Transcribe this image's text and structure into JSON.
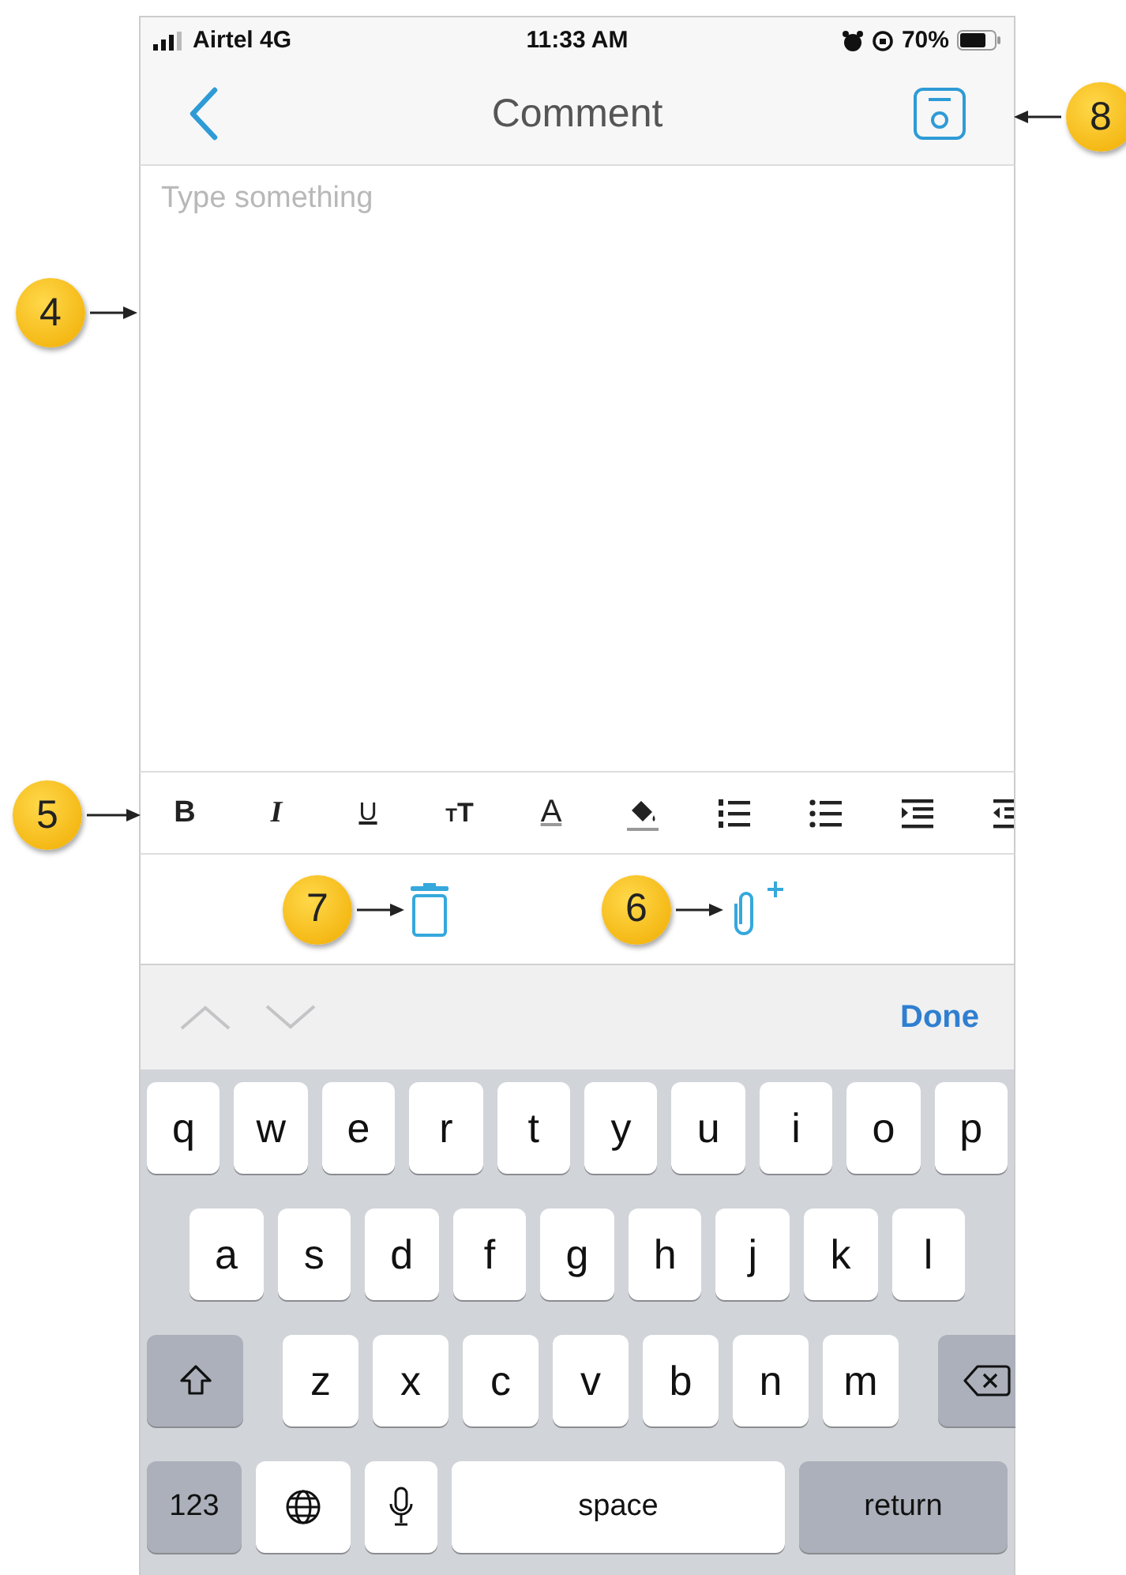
{
  "status_bar": {
    "carrier": "Airtel 4G",
    "time": "11:33 AM",
    "battery": "70%"
  },
  "nav": {
    "title": "Comment",
    "callout": "8"
  },
  "editor": {
    "placeholder": "Type something",
    "callout": "4"
  },
  "format_toolbar": {
    "callout": "5",
    "tools": [
      {
        "kind": "bold",
        "label": "B"
      },
      {
        "kind": "italic",
        "label": "I"
      },
      {
        "kind": "underline",
        "label": "U"
      },
      {
        "kind": "size",
        "label": "TT"
      },
      {
        "kind": "color",
        "label": "A"
      },
      {
        "kind": "fill"
      },
      {
        "kind": "numbered"
      },
      {
        "kind": "bulleted"
      },
      {
        "kind": "indent"
      },
      {
        "kind": "outdent"
      }
    ]
  },
  "actions": [
    {
      "kind": "delete",
      "callout": "7"
    },
    {
      "kind": "attach",
      "callout": "6"
    }
  ],
  "accessory": {
    "done": "Done"
  },
  "keyboard": {
    "rows": [
      {
        "keys": [
          {
            "kind": "letter",
            "label": "q"
          },
          {
            "kind": "letter",
            "label": "w"
          },
          {
            "kind": "letter",
            "label": "e"
          },
          {
            "kind": "letter",
            "label": "r"
          },
          {
            "kind": "letter",
            "label": "t"
          },
          {
            "kind": "letter",
            "label": "y"
          },
          {
            "kind": "letter",
            "label": "u"
          },
          {
            "kind": "letter",
            "label": "i"
          },
          {
            "kind": "letter",
            "label": "o"
          },
          {
            "kind": "letter",
            "label": "p"
          }
        ]
      },
      {
        "keys": [
          {
            "kind": "letter",
            "label": "a"
          },
          {
            "kind": "letter",
            "label": "s"
          },
          {
            "kind": "letter",
            "label": "d"
          },
          {
            "kind": "letter",
            "label": "f"
          },
          {
            "kind": "letter",
            "label": "g"
          },
          {
            "kind": "letter",
            "label": "h"
          },
          {
            "kind": "letter",
            "label": "j"
          },
          {
            "kind": "letter",
            "label": "k"
          },
          {
            "kind": "letter",
            "label": "l"
          }
        ]
      },
      {
        "keys": [
          {
            "kind": "shift"
          },
          {
            "kind": "letter",
            "label": "z"
          },
          {
            "kind": "letter",
            "label": "x"
          },
          {
            "kind": "letter",
            "label": "c"
          },
          {
            "kind": "letter",
            "label": "v"
          },
          {
            "kind": "letter",
            "label": "b"
          },
          {
            "kind": "letter",
            "label": "n"
          },
          {
            "kind": "letter",
            "label": "m"
          },
          {
            "kind": "delete"
          }
        ]
      },
      {
        "keys": [
          {
            "kind": "mode",
            "label": "123"
          },
          {
            "kind": "globe"
          },
          {
            "kind": "mic"
          },
          {
            "kind": "space",
            "label": "space"
          },
          {
            "kind": "return",
            "label": "return"
          }
        ]
      }
    ]
  }
}
